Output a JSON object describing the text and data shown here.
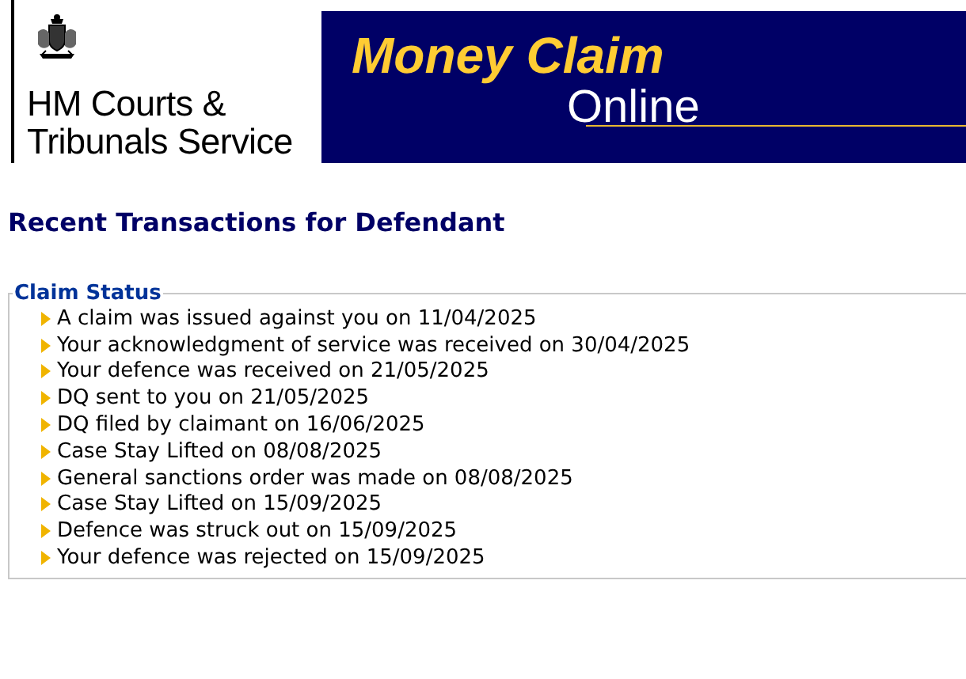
{
  "header": {
    "agency_lines": [
      "HM Courts &",
      "Tribunals Service"
    ],
    "banner_title": "Money Claim",
    "banner_subtitle": "Online"
  },
  "page_title": "Recent Transactions for Defendant",
  "claim_status": {
    "legend": "Claim Status",
    "items": [
      "A claim was issued against you on 11/04/2025",
      "Your acknowledgment of service was received on 30/04/2025",
      "Your defence was received on 21/05/2025",
      "DQ sent to you on 21/05/2025",
      "DQ filed by claimant on 16/06/2025",
      "Case Stay Lifted on 08/08/2025",
      "General sanctions order was made on 08/08/2025",
      "Case Stay Lifted on 15/09/2025",
      "Defence was struck out on 15/09/2025",
      "Your defence was rejected on 15/09/2025"
    ]
  }
}
